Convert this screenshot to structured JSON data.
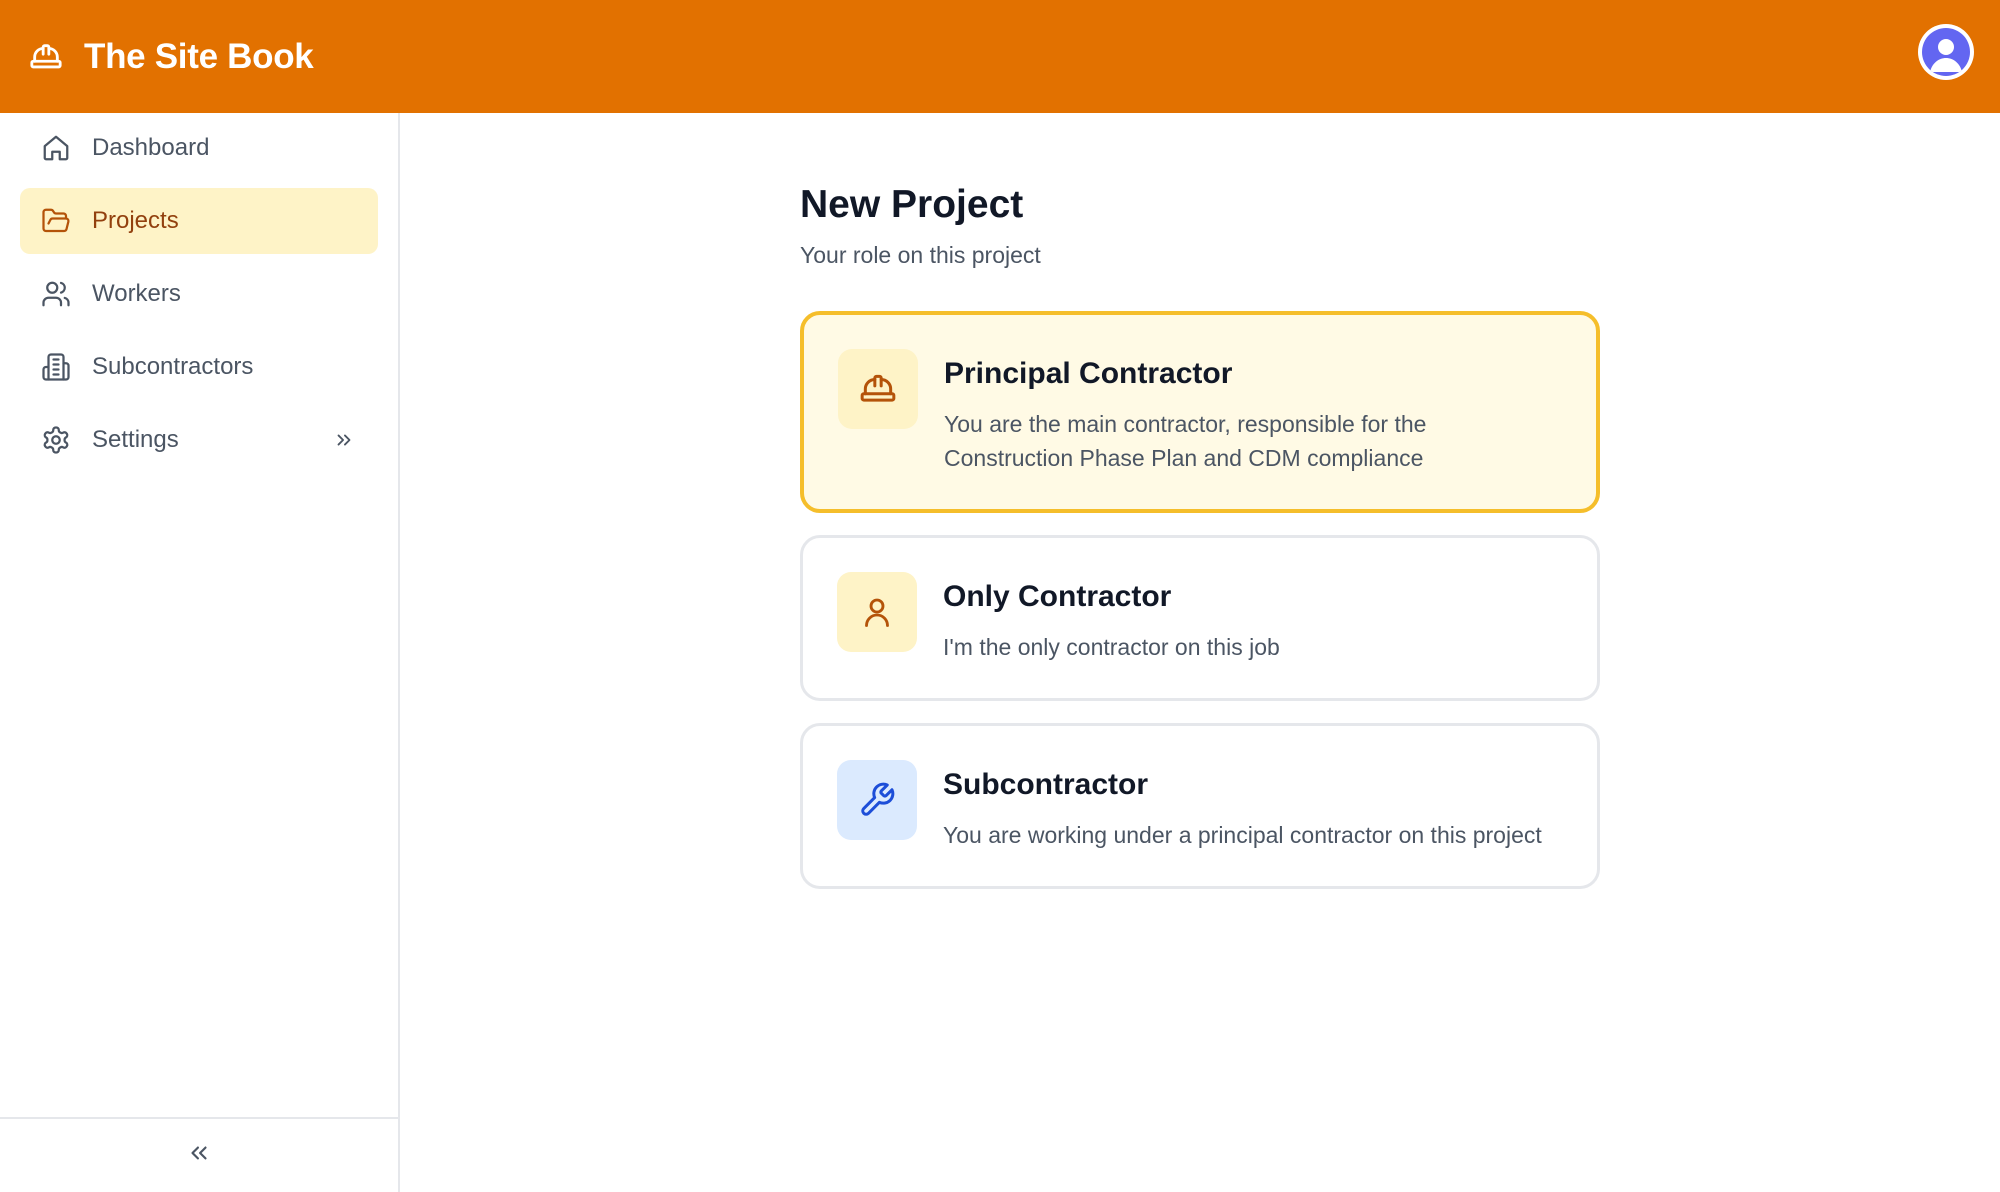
{
  "app": {
    "title": "The Site Book",
    "brand_color": "#E27100"
  },
  "header": {
    "brand_icon": "hardhat-icon",
    "avatar_icon": "user-avatar-icon"
  },
  "sidebar": {
    "items": [
      {
        "label": "Dashboard",
        "icon": "home-icon",
        "active": false
      },
      {
        "label": "Projects",
        "icon": "folder-open-icon",
        "active": true
      },
      {
        "label": "Workers",
        "icon": "users-icon",
        "active": false
      },
      {
        "label": "Subcontractors",
        "icon": "building-icon",
        "active": false
      },
      {
        "label": "Settings",
        "icon": "gear-icon",
        "active": false,
        "expand_icon": "chevrons-right-icon"
      }
    ],
    "collapse_icon": "chevrons-left-icon"
  },
  "main": {
    "title": "New Project",
    "subtitle": "Your role on this project",
    "roles": [
      {
        "title": "Principal Contractor",
        "description": "You are the main contractor, responsible for the Construction Phase Plan and CDM compliance",
        "icon": "hardhat-icon",
        "selected": true
      },
      {
        "title": "Only Contractor",
        "description": "I'm the only contractor on this job",
        "icon": "user-icon",
        "selected": false
      },
      {
        "title": "Subcontractor",
        "description": "You are working under a principal contractor on this project",
        "icon": "wrench-icon",
        "selected": false
      }
    ]
  },
  "colors": {
    "accent": "#E27100",
    "selected_border": "#F5BE2B",
    "selected_bg": "#FFFAE5",
    "active_nav_bg": "#FEF3C7",
    "amber_icon": "#B45309",
    "blue_icon": "#1D4ED8"
  }
}
